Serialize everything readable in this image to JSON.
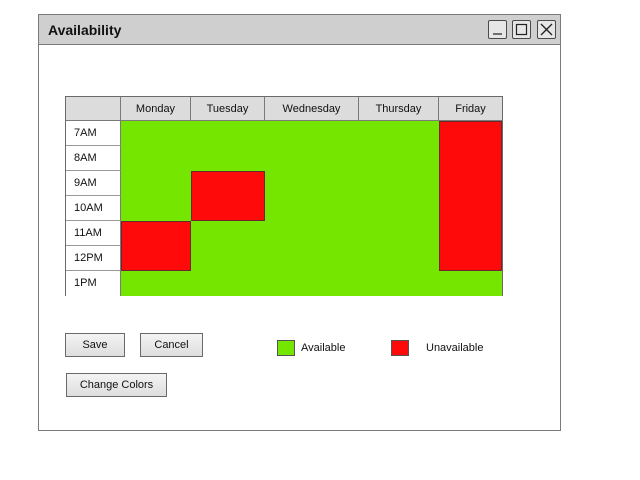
{
  "window": {
    "title": "Availability"
  },
  "grid": {
    "corner": "",
    "days": [
      "Monday",
      "Tuesday",
      "Wednesday",
      "Thursday",
      "Friday"
    ],
    "times": [
      "7AM",
      "8AM",
      "9AM",
      "10AM",
      "11AM",
      "12PM",
      "1PM"
    ],
    "availability": {
      "Monday": [
        "available",
        "available",
        "available",
        "available",
        "unavailable",
        "unavailable",
        "available"
      ],
      "Tuesday": [
        "available",
        "available",
        "unavailable",
        "unavailable",
        "available",
        "available",
        "available"
      ],
      "Wednesday": [
        "available",
        "available",
        "available",
        "available",
        "available",
        "available",
        "available"
      ],
      "Thursday": [
        "available",
        "available",
        "available",
        "available",
        "available",
        "available",
        "available"
      ],
      "Friday": [
        "unavailable",
        "unavailable",
        "unavailable",
        "unavailable",
        "unavailable",
        "unavailable",
        "available"
      ]
    }
  },
  "buttons": {
    "save": "Save",
    "cancel": "Cancel",
    "change_colors": "Change Colors"
  },
  "legend": {
    "available_label": "Available",
    "unavailable_label": "Unavailable",
    "available_color": "#74e600",
    "unavailable_color": "#ff0a0a"
  }
}
